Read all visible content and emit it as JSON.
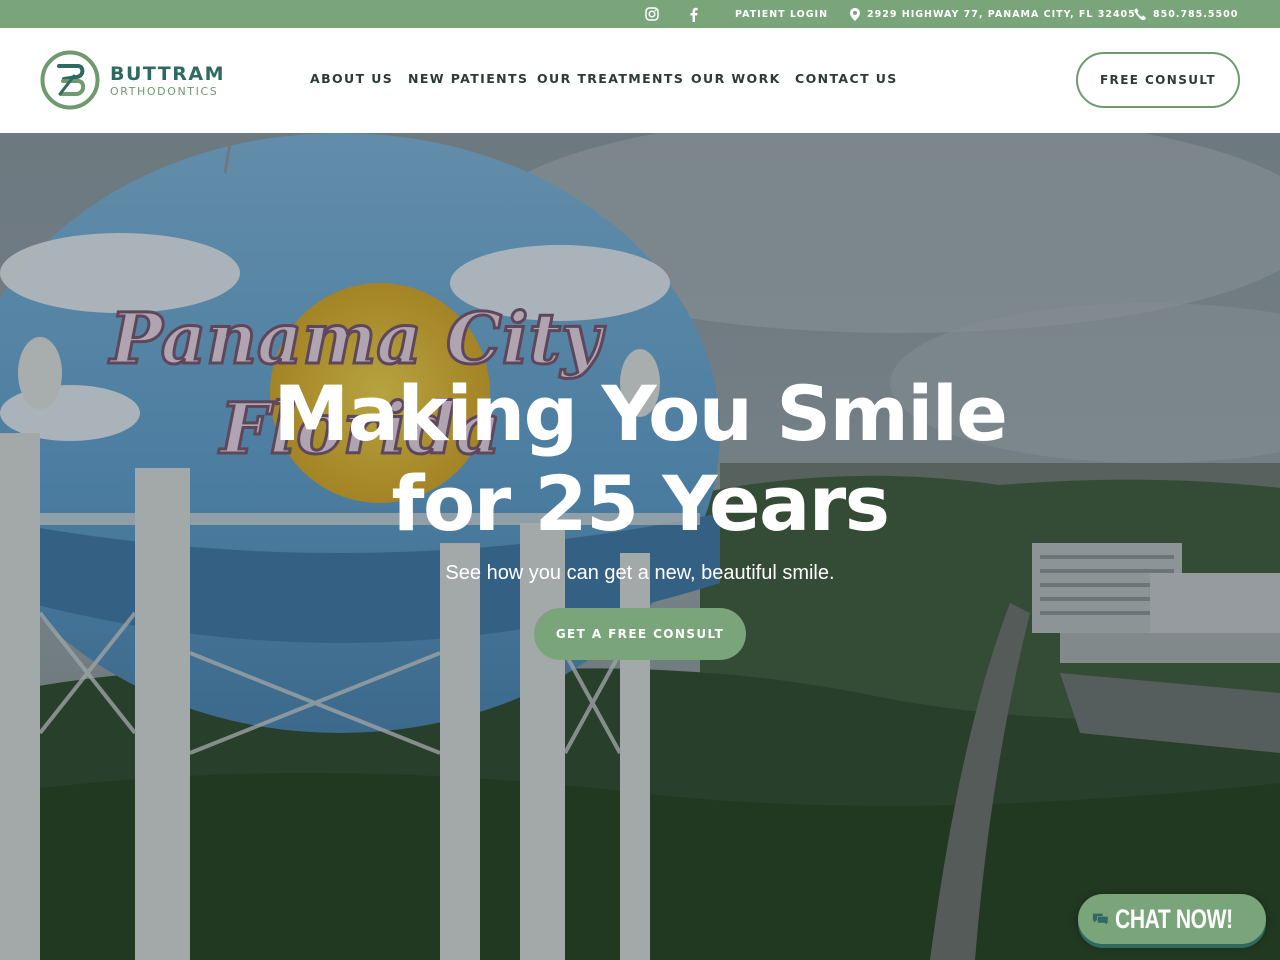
{
  "topbar": {
    "icons": [
      "instagram-icon",
      "facebook-icon",
      "map-pin-icon",
      "phone-icon"
    ],
    "patient_login": "PATIENT LOGIN",
    "address": "2929 HIGHWAY 77, PANAMA CITY, FL 32405",
    "phone": "850.785.5500"
  },
  "header": {
    "logo_name": "BUTTRAM",
    "logo_sub": "ORTHODONTICS",
    "nav": [
      "ABOUT US",
      "NEW PATIENTS",
      "OUR TREATMENTS",
      "OUR WORK",
      "CONTACT US"
    ],
    "cta": "FREE CONSULT"
  },
  "hero": {
    "title_line1": "Making You Smile",
    "title_line2": "for 25 Years",
    "subtitle": "See how you can get a new, beautiful smile.",
    "cta": "GET A FREE CONSULT",
    "background_text": "Panama City Florida"
  },
  "chat": {
    "label": "CHAT NOW!"
  },
  "colors": {
    "brand_green": "#7aa57a",
    "brand_teal": "#2f6a62",
    "nav_text": "#2d3a37"
  }
}
